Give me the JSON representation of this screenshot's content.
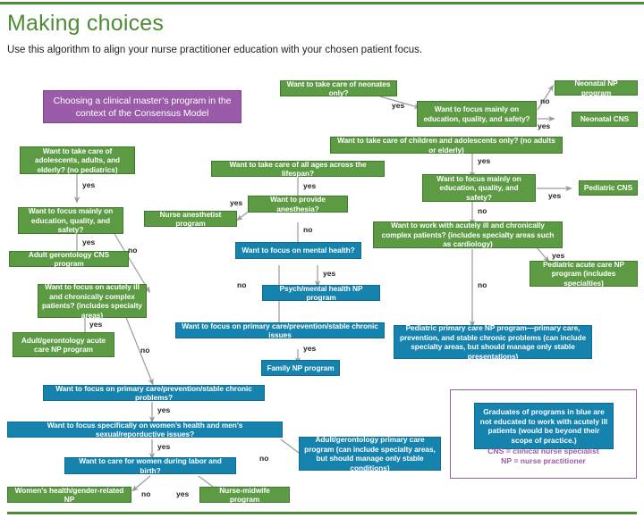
{
  "header": {
    "title": "Making choices",
    "subtitle": "Use this  algorithm to align your nurse practitioner education with your chosen patient focus."
  },
  "colors": {
    "green": "#5C9A43",
    "blue": "#1583AE",
    "purple": "#9A5BA8",
    "rule": "#4E8B36",
    "text_dark": "#231f20"
  },
  "legend": {
    "blue_note": "Graduates of programs in blue are not educated to work with acutely ill patients (would be beyond their scope of practice.)",
    "cns_def": "CNS = clinical nurse specialist",
    "np_def": "NP = nurse practitioner"
  },
  "nodes": {
    "title_box": "Choosing a clinical master’s program in the context of the Consensus Model",
    "q_adolescents": "Want to take care of adolescents, adults, and elderly? (no pediatrics)",
    "q_focus_eqs_adult": "Want to focus mainly on education, quality, and safety?",
    "r_adult_gero_cns": "Adult gerontology CNS program",
    "q_acutely_ill_adult": "Want to focus on acutely ill and chronically complex patients? (includes specialty areas)",
    "r_adult_gero_acute": "Adult/gerontology acute care NP program",
    "q_primary_care_adult": "Want to focus on primary care/prevention/stable chronic problems?",
    "q_womens_health": "Want to focus specifically on women’s health and men’s sexual/reporductive issues?",
    "q_labor_birth": "Want to care for women during labor and birth?",
    "r_womens_health_np": "Women’s health/gender-related NP",
    "r_nurse_midwife": "Nurse-midwife program",
    "r_adult_gero_primary": "Adult/gerontology primary care program (can include specialty areas, but should manage only stable conditions)",
    "q_all_ages": "Want to take care of all ages across the lifespan?",
    "q_anesthesia": "Want to provide anesthesia?",
    "r_nurse_anesthetist": "Nurse anesthetist program",
    "q_mental_health": "Want to focus on mental health?",
    "r_psych_np": "Psych/mental health NP program",
    "q_primary_care_family": "Want to focus on primary care/prevention/stable chronic issues",
    "r_family_np": "Family NP program",
    "q_neonates": "Want to take care of neonates only?",
    "q_focus_eqs_neonatal": "Want to focus mainly on education, quality, and safety?",
    "r_neonatal_np": "Neonatal NP program",
    "r_neonatal_cns": "Neonatal CNS",
    "q_children": "Want to take care of children and adolescents only? (no adults or elderly)",
    "q_focus_eqs_peds": "Want to focus mainly on education, quality, and safety?",
    "r_pediatric_cns": "Pediatric CNS",
    "q_acutely_ill_peds": "Want to work with acutely ill and chronically complex patients? (includes specialty areas such as cardiology)",
    "r_peds_acute_np": "Pediatric acute care NP program (includes specialties)",
    "r_peds_primary_np": "Pediatric primary care NP program—primary care, prevention, and stable chronic problems (can include specialty areas, but should manage only stable presentations)"
  },
  "edge_labels": {
    "yes": "yes",
    "no": "no",
    "e1": "yes",
    "e2": "yes",
    "e3": "no",
    "e4": "yes",
    "e5": "no",
    "e6": "yes",
    "e7": "yes",
    "e8": "no",
    "e9": "yes",
    "e10": "yes",
    "e11": "yes",
    "e12": "no",
    "e13": "yes",
    "e14": "no",
    "e15": "yes",
    "e16": "no",
    "e17": "yes",
    "e18": "yes",
    "e19": "no",
    "e20": "yes",
    "e21": "no"
  }
}
